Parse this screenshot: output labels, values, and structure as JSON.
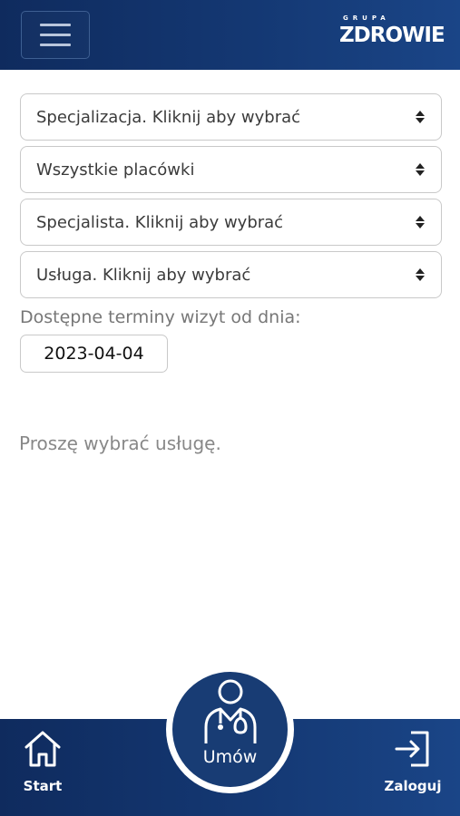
{
  "header": {
    "menu_icon": "hamburger-menu-icon",
    "logo_small": "GRUPA",
    "logo_big": "ZDROWIE"
  },
  "form": {
    "specialization": "Specjalizacja. Kliknij aby wybrać",
    "facility": "Wszystkie placówki",
    "specialist": "Specjalista. Kliknij aby wybrać",
    "service": "Usługa. Kliknij aby wybrać",
    "date_label": "Dostępne terminy wizyt od dnia:",
    "date_value": "2023-04-04"
  },
  "message": "Proszę wybrać usługę.",
  "bottom_nav": {
    "start_label": "Start",
    "start_icon": "home-icon",
    "book_label": "Umów",
    "book_icon": "doctor-icon",
    "login_label": "Zaloguj",
    "login_icon": "login-icon"
  },
  "colors": {
    "bar_dark": "#0f2b5e",
    "bar_light": "#1a4587",
    "fab": "#183c74"
  }
}
